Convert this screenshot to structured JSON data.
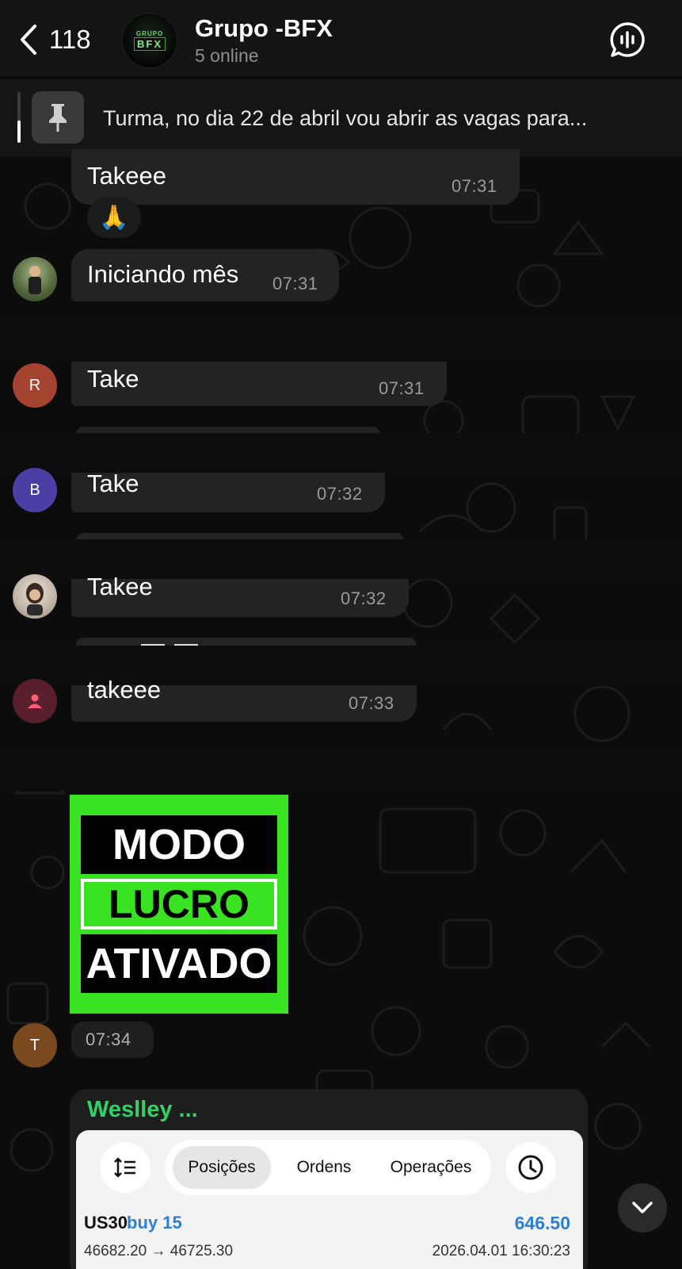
{
  "header": {
    "back_count": "118",
    "group_title": "Grupo -BFX",
    "online_status": "5 online",
    "avatar_top_text": "GRUPO",
    "avatar_logo_text": "BFX"
  },
  "pinned": {
    "text": "Turma, no dia 22 de abril vou abrir as vagas para..."
  },
  "messages": [
    {
      "text": "Takeee",
      "time": "07:31",
      "reaction": "🙏"
    },
    {
      "text": "Iniciando mês",
      "time": "07:31"
    },
    {
      "avatar_letter": "R",
      "text": "Take",
      "time": "07:31"
    },
    {
      "avatar_letter": "B",
      "text": "Take",
      "time": "07:32"
    },
    {
      "text": "Takee",
      "time": "07:32"
    },
    {
      "text": "takeee",
      "time": "07:33"
    }
  ],
  "sticker": {
    "line1": "MODO",
    "line2": "LUCRO",
    "line3": "ATIVADO",
    "time": "07:34",
    "avatar_letter": "T"
  },
  "forwarded": {
    "sender": "Weslley ...",
    "tabs": [
      "Posições",
      "Ordens",
      "Operações"
    ],
    "active_tab": "Posições",
    "symbol": "US30",
    "side": "buy 15",
    "profit": "646.50",
    "prices": "46682.20 → 46725.30",
    "datetime": "2026.04.01 16:30:23"
  },
  "colors": {
    "accent_green": "#33d06a",
    "sticker_green": "#39e321",
    "trade_blue": "#2d7fd1",
    "avatar_R": "#a4432f",
    "avatar_B": "#4b3fa6",
    "avatar_T": "#7a4a1e",
    "avatar_pink": "#5a1f2c"
  }
}
